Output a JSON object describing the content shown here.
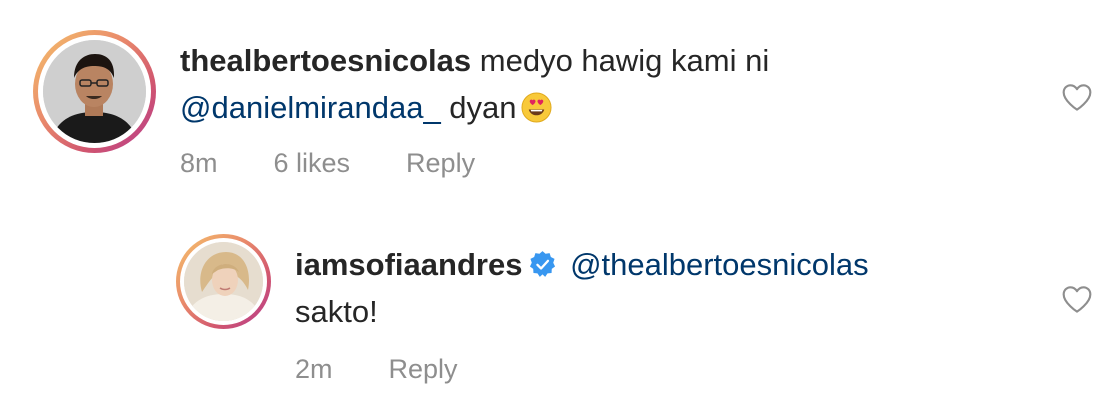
{
  "comments": [
    {
      "username": "thealbertoesnicolas",
      "text_before": " medyo hawig kami ni ",
      "mention": "@danielmirandaa_",
      "text_after": " dyan",
      "emoji": "heart-eyes-emoji",
      "time": "8m",
      "likes": "6 likes",
      "reply_label": "Reply",
      "like_icon": "heart-outline-icon"
    },
    {
      "username": "iamsofiaandres",
      "verified": true,
      "mention": "@thealbertoesnicolas",
      "text": "sakto!",
      "time": "2m",
      "reply_label": "Reply",
      "like_icon": "heart-outline-icon"
    }
  ]
}
